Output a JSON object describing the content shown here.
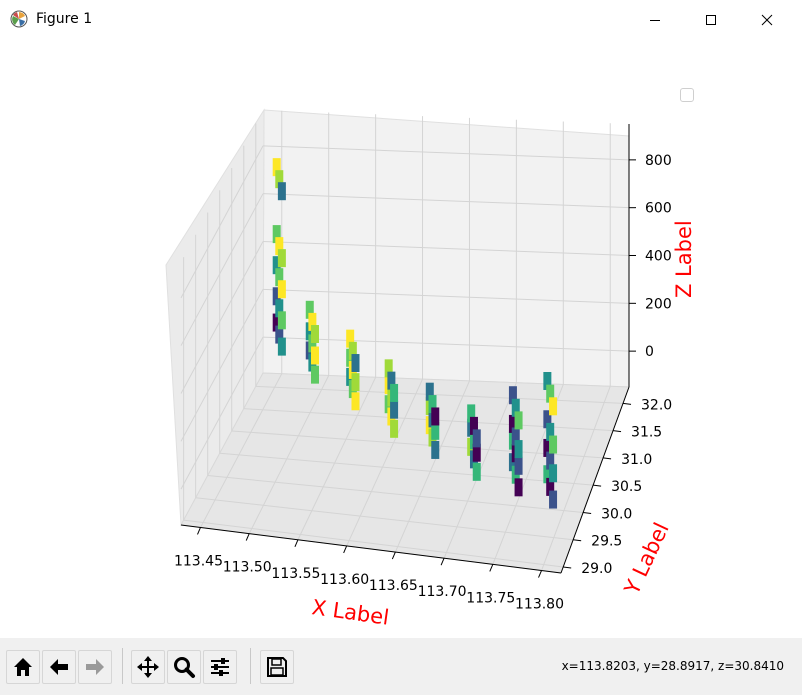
{
  "window": {
    "title": "Figure 1",
    "app_icon": "matplotlib-icon",
    "buttons": [
      "minimize-icon",
      "maximize-icon",
      "close-icon"
    ]
  },
  "toolbar": {
    "buttons": [
      "home-icon",
      "back-arrow-icon",
      "forward-arrow-icon",
      "pan-icon",
      "zoom-icon",
      "configure-subplots-icon",
      "save-icon"
    ],
    "coords": "x=113.8203, y=28.8917, z=30.8410"
  },
  "chart_data": {
    "type": "scatter",
    "projection": "3d",
    "xlabel": "X Label",
    "ylabel": "Y Label",
    "zlabel": "Z Label",
    "label_color": "#ff0000",
    "x_ticks": [
      "113.45",
      "113.50",
      "113.55",
      "113.60",
      "113.65",
      "113.70",
      "113.75",
      "113.80"
    ],
    "y_ticks": [
      "29.0",
      "29.5",
      "30.0",
      "30.5",
      "31.0",
      "31.5",
      "32.0"
    ],
    "z_ticks": [
      "0",
      "200",
      "400",
      "600",
      "800"
    ],
    "xlim": [
      113.43,
      113.82
    ],
    "ylim": [
      28.89,
      32.3
    ],
    "zlim": [
      -150,
      950
    ],
    "grid": true,
    "legend": "top-right (empty)",
    "colormap": "viridis",
    "level_colors": [
      "#440154",
      "#3b528b",
      "#21918c",
      "#5ec962",
      "#fde725",
      "#a0da39",
      "#2c728e",
      "#35b779"
    ],
    "series": [
      {
        "x": 113.46,
        "y": 31.8,
        "z_values": [
          150,
          260,
          390,
          520,
          800
        ]
      },
      {
        "x": 113.5,
        "y": 31.6,
        "z_values": [
          80,
          160,
          250
        ]
      },
      {
        "x": 113.55,
        "y": 31.3,
        "z_values": [
          40,
          120,
          200
        ]
      },
      {
        "x": 113.6,
        "y": 30.9,
        "z_values": [
          20,
          100,
          170
        ]
      },
      {
        "x": 113.65,
        "y": 30.6,
        "z_values": [
          10,
          90,
          150
        ]
      },
      {
        "x": 113.7,
        "y": 30.3,
        "z_values": [
          0,
          80,
          140
        ]
      },
      {
        "x": 113.75,
        "y": 30.0,
        "z_values": [
          20,
          110,
          180,
          300
        ]
      },
      {
        "x": 113.79,
        "y": 29.8,
        "z_values": [
          30,
          140,
          260,
          420
        ]
      }
    ]
  }
}
